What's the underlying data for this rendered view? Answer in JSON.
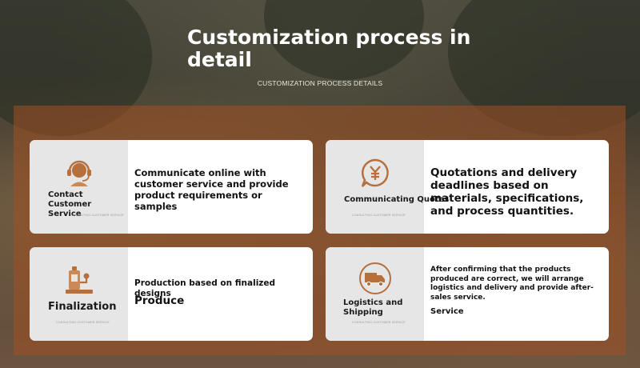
{
  "header": {
    "title": "Customization process in detail",
    "subtitle": "CUSTOMIZATION PROCESS DETAILS"
  },
  "cards": [
    {
      "label": "Contact Customer Service",
      "small_text": "CONSULTING CUSTOMER SERVICE",
      "description": "Communicate online with customer service and provide product requirements or samples",
      "icon": "headset-support-icon"
    },
    {
      "label": "Communicating Quotes",
      "small_text": "CONSULTING CUSTOMER SERVICE",
      "description": "Quotations and delivery deadlines based on materials, specifications, and process quantities.",
      "icon": "yen-quote-bubble-icon"
    },
    {
      "label": "Finalization",
      "small_text": "CONSULTING CUSTOMER SERVICE",
      "description": "Production based on finalized designs",
      "sub_text": "Produce",
      "icon": "production-machine-icon"
    },
    {
      "label": "Logistics and Shipping",
      "small_text": "CONSULTING CUSTOMER SERVICE",
      "description": "After confirming that the products produced are correct, we will arrange logistics and delivery and provide after-sales service.",
      "sub_text": "Service",
      "icon": "delivery-truck-icon"
    }
  ],
  "colors": {
    "accent": "#b5703e",
    "panel": "#a0502380",
    "card_left": "#e6e6e6"
  }
}
